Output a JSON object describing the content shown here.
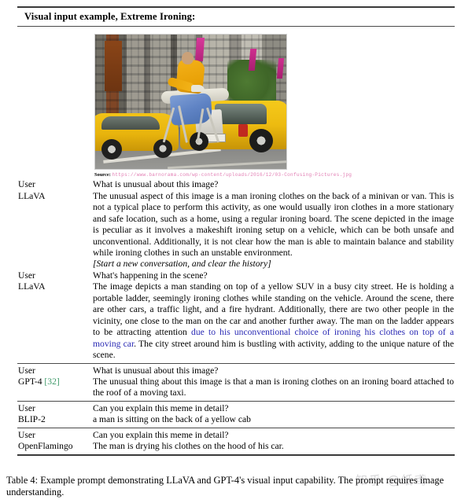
{
  "table": {
    "header": "Visual input example, Extreme Ironing:",
    "source_label": "Source:",
    "source_url": "https://www.barnorama.com/wp-content/uploads/2016/12/03-Confusing-Pictures.jpg",
    "image_alt": "Man in a yellow shirt ironing clothes on an ironing board attached to the back of a yellow SUV taxi in a busy city street, with another yellow cab beside it",
    "colors": {
      "url_pink": "#e27fb4",
      "highlight_blue": "#2a2ab4",
      "citation_green": "#3f9a6a",
      "rule_dark": "#3a3a3a"
    },
    "rows": [
      {
        "speaker": "User",
        "text": "What is unusual about this image?"
      },
      {
        "speaker": "LLaVA",
        "text": "The unusual aspect of this image is a man ironing clothes on the back of a minivan or van. This is not a typical place to perform this activity, as one would usually iron clothes in a more stationary and safe location, such as a home, using a regular ironing board. The scene depicted in the image is peculiar as it involves a makeshift ironing setup on a vehicle, which can be both unsafe and unconventional. Additionally, it is not clear how the man is able to maintain balance and stability while ironing clothes in such an unstable environment."
      },
      {
        "speaker": "",
        "text": "[Start a new conversation, and clear the history]"
      },
      {
        "speaker": "User",
        "text": "What's happening in the scene?"
      },
      {
        "speaker": "LLaVA",
        "text_before": "The image depicts a man standing on top of a yellow SUV in a busy city street. He is holding a portable ladder, seemingly ironing clothes while standing on the vehicle. Around the scene, there are other cars, a traffic light, and a fire hydrant. Additionally, there are two other people in the vicinity, one close to the man on the car and another further away. The man on the ladder appears to be attracting attention ",
        "text_highlight": "due to his unconventional choice of ironing his clothes on top of a moving car",
        "text_after": ". The city street around him is bustling with activity, adding to the unique nature of the scene."
      },
      {
        "speaker": "User",
        "text": "What is unusual about this image?"
      },
      {
        "speaker": "GPT-4",
        "citation": "[32]",
        "citation_number": "32",
        "text": "The unusual thing about this image is that a man is ironing clothes on an ironing board attached to the roof of a moving taxi."
      },
      {
        "speaker": "User",
        "text": "Can you explain this meme in detail?"
      },
      {
        "speaker": "BLIP-2",
        "text": "a man is sitting on the back of a yellow cab"
      },
      {
        "speaker": "User",
        "text": "Can you explain this meme in detail?"
      },
      {
        "speaker": "OpenFlamingo",
        "text": "The man is drying his clothes on the hood of his car."
      }
    ]
  },
  "caption": {
    "label": "Table 4:",
    "text": "Example prompt demonstrating LLaVA and GPT-4's visual input capability. The prompt requires image understanding."
  },
  "watermark": {
    "line1": "知乎 @纸鸢",
    "line2": ""
  }
}
